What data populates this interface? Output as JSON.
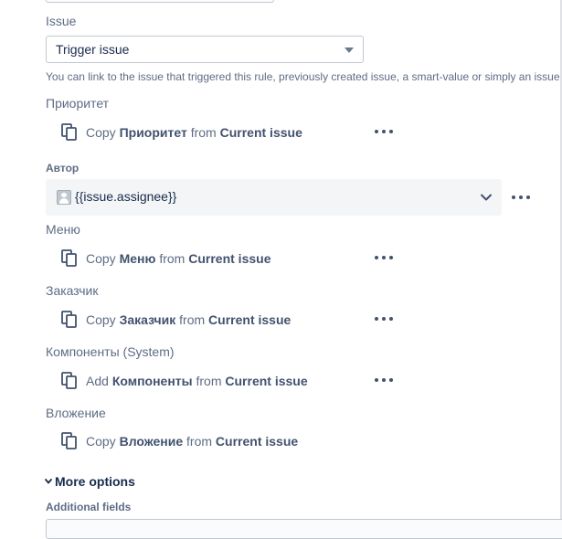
{
  "issue_field": {
    "label": "Issue",
    "value": "Trigger issue",
    "helper": "You can link to the issue that triggered this rule, previously created issue, a smart-value or simply an issue"
  },
  "fields": [
    {
      "label": "Приоритет",
      "action": "Copy",
      "field": "Приоритет",
      "from": "from",
      "source": "Current issue"
    },
    {
      "label": "Меню",
      "action": "Copy",
      "field": "Меню",
      "from": "from",
      "source": "Current issue"
    },
    {
      "label": "Заказчик",
      "action": "Copy",
      "field": "Заказчик",
      "from": "from",
      "source": "Current issue"
    },
    {
      "label": "Компоненты (System)",
      "action": "Add",
      "field": "Компоненты",
      "from": "from",
      "source": "Current issue"
    },
    {
      "label": "Вложение",
      "action": "Copy",
      "field": "Вложение",
      "from": "from",
      "source": "Current issue"
    }
  ],
  "assignee_field": {
    "label": "Автор",
    "value": "{{issue.assignee}}"
  },
  "more_options": {
    "label": "More options"
  },
  "additional_fields": {
    "label": "Additional fields"
  },
  "icons": {
    "copy": "copy-icon",
    "more": "more-icon",
    "caret": "caret-down-icon",
    "chevron": "chevron-down-icon",
    "avatar": "avatar-icon"
  },
  "colors": {
    "text": "#172b4d",
    "subtle": "#5e6c84",
    "field_bg": "#f4f5f7"
  }
}
